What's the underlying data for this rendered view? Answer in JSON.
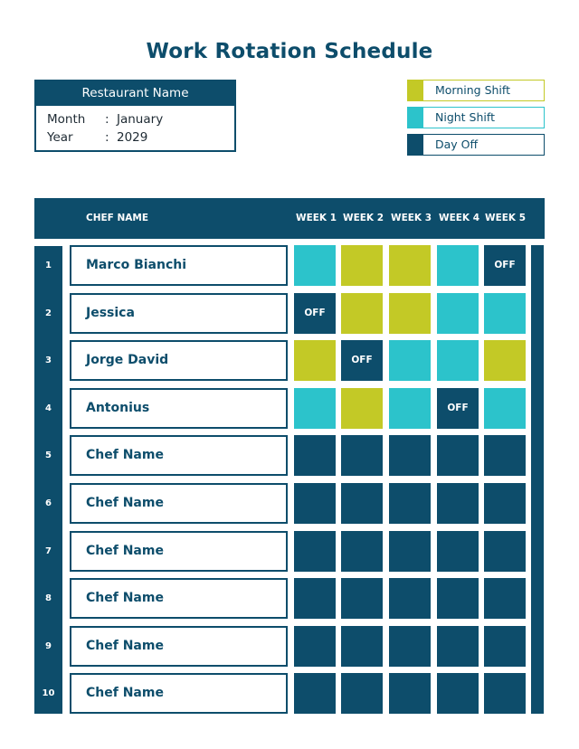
{
  "title": "Work Rotation Schedule",
  "info": {
    "restaurant_name": "Restaurant Name",
    "month_label": "Month",
    "month_value": "January",
    "year_label": "Year",
    "year_value": "2029",
    "separator": ":"
  },
  "legend": [
    {
      "label": "Morning Shift",
      "key": "morning",
      "color": "#c3c926"
    },
    {
      "label": "Night Shift",
      "key": "night",
      "color": "#2cc3cb"
    },
    {
      "label": "Day Off",
      "key": "off",
      "color": "#0d4d6b"
    }
  ],
  "table": {
    "headers": {
      "chef_name": "CHEF NAME",
      "weeks": [
        "WEEK 1",
        "WEEK 2",
        "WEEK 3",
        "WEEK 4",
        "WEEK 5"
      ]
    },
    "off_label": "OFF",
    "rows": [
      {
        "num": "1",
        "name": "Marco Bianchi",
        "shifts": [
          "night",
          "morning",
          "morning",
          "night",
          "off"
        ]
      },
      {
        "num": "2",
        "name": "Jessica",
        "shifts": [
          "off",
          "morning",
          "morning",
          "night",
          "night"
        ]
      },
      {
        "num": "3",
        "name": "Jorge David",
        "shifts": [
          "morning",
          "off",
          "night",
          "night",
          "morning"
        ]
      },
      {
        "num": "4",
        "name": "Antonius",
        "shifts": [
          "night",
          "morning",
          "night",
          "off",
          "night"
        ]
      },
      {
        "num": "5",
        "name": "Chef Name",
        "shifts": [
          "empty",
          "empty",
          "empty",
          "empty",
          "empty"
        ]
      },
      {
        "num": "6",
        "name": "Chef Name",
        "shifts": [
          "empty",
          "empty",
          "empty",
          "empty",
          "empty"
        ]
      },
      {
        "num": "7",
        "name": "Chef Name",
        "shifts": [
          "empty",
          "empty",
          "empty",
          "empty",
          "empty"
        ]
      },
      {
        "num": "8",
        "name": "Chef Name",
        "shifts": [
          "empty",
          "empty",
          "empty",
          "empty",
          "empty"
        ]
      },
      {
        "num": "9",
        "name": "Chef Name",
        "shifts": [
          "empty",
          "empty",
          "empty",
          "empty",
          "empty"
        ]
      },
      {
        "num": "10",
        "name": "Chef Name",
        "shifts": [
          "empty",
          "empty",
          "empty",
          "empty",
          "empty"
        ]
      }
    ]
  },
  "colors": {
    "morning": "#c3c926",
    "night": "#2cc3cb",
    "off": "#0d4d6b",
    "empty": "#0d4d6b",
    "primary": "#0d4d6b"
  }
}
